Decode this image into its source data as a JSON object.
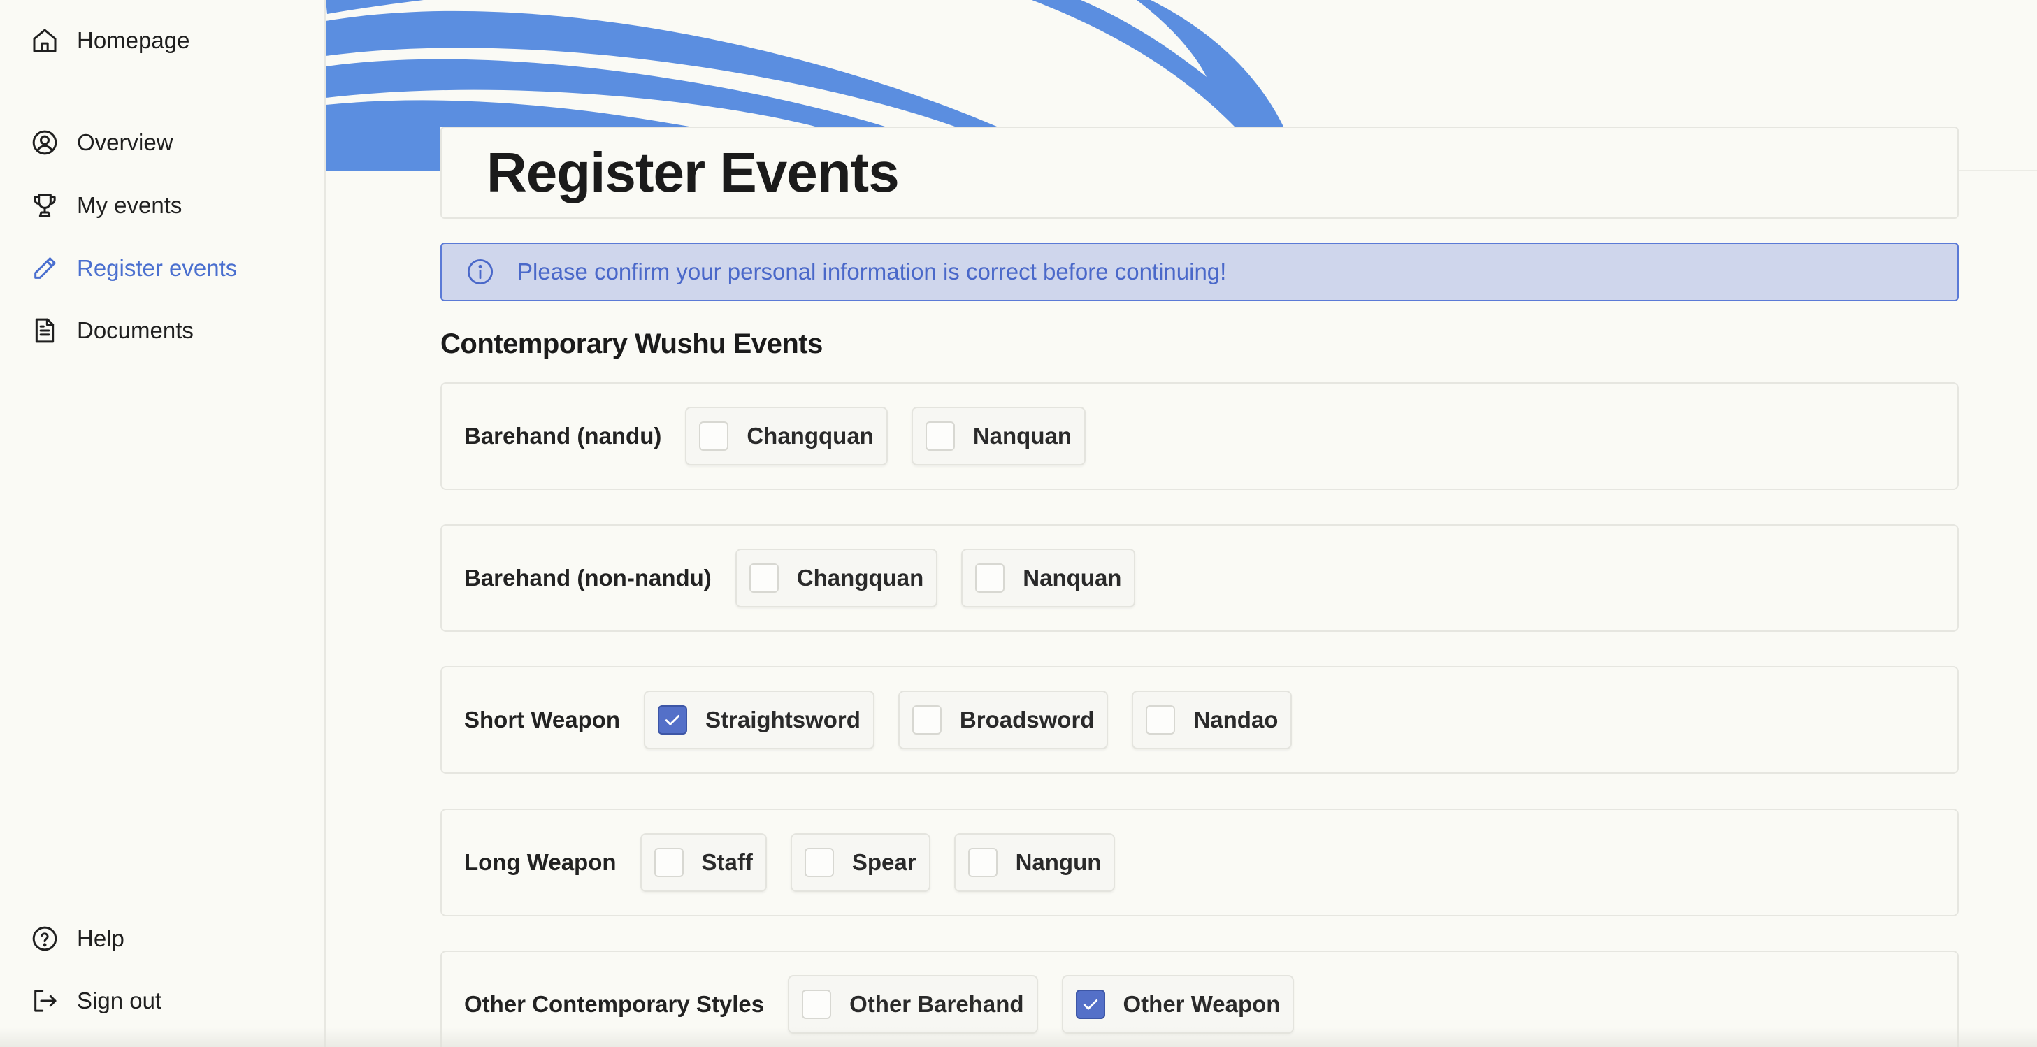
{
  "sidebar": {
    "items": [
      {
        "label": "Homepage",
        "icon": "home-icon"
      },
      {
        "label": "Overview",
        "icon": "user-circle-icon"
      },
      {
        "label": "My events",
        "icon": "trophy-icon"
      },
      {
        "label": "Register events",
        "icon": "pencil-icon",
        "active": true
      },
      {
        "label": "Documents",
        "icon": "document-icon"
      },
      {
        "label": "Help",
        "icon": "help-circle-icon"
      },
      {
        "label": "Sign out",
        "icon": "sign-out-icon"
      }
    ]
  },
  "colors": {
    "accent": "#4a6fcf",
    "banner_brush": "#5b8ee0",
    "alert_bg": "#cfd6ec",
    "checked": "#5470c8"
  },
  "page": {
    "title": "Register Events",
    "alert": "Please confirm your personal information is correct before continuing!",
    "section_title": "Contemporary Wushu Events"
  },
  "events": [
    {
      "label": "Barehand (nandu)",
      "options": [
        {
          "label": "Changquan",
          "checked": false
        },
        {
          "label": "Nanquan",
          "checked": false
        }
      ]
    },
    {
      "label": "Barehand (non-nandu)",
      "options": [
        {
          "label": "Changquan",
          "checked": false
        },
        {
          "label": "Nanquan",
          "checked": false
        }
      ]
    },
    {
      "label": "Short Weapon",
      "options": [
        {
          "label": "Straightsword",
          "checked": true
        },
        {
          "label": "Broadsword",
          "checked": false
        },
        {
          "label": "Nandao",
          "checked": false
        }
      ]
    },
    {
      "label": "Long Weapon",
      "options": [
        {
          "label": "Staff",
          "checked": false
        },
        {
          "label": "Spear",
          "checked": false
        },
        {
          "label": "Nangun",
          "checked": false
        }
      ]
    },
    {
      "label": "Other Contemporary Styles",
      "options": [
        {
          "label": "Other Barehand",
          "checked": false
        },
        {
          "label": "Other Weapon",
          "checked": true
        }
      ]
    }
  ]
}
